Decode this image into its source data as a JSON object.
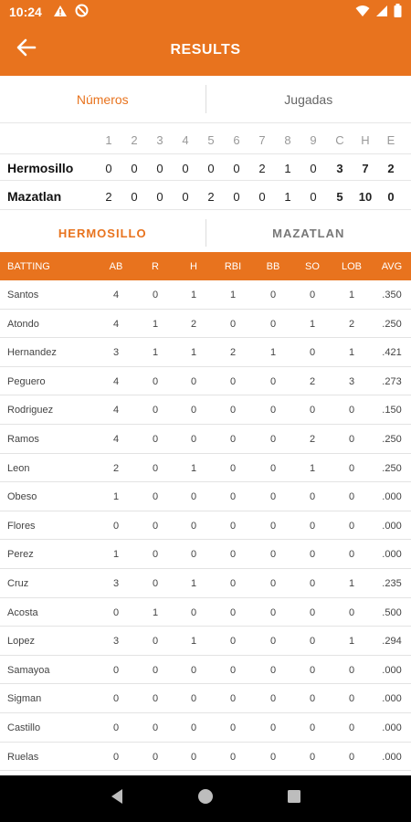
{
  "status_bar": {
    "time": "10:24",
    "left_icons": [
      "alert-icon",
      "no-disturb-icon"
    ],
    "right_icons": [
      "wifi-icon",
      "signal-icon",
      "battery-icon"
    ]
  },
  "app_bar": {
    "title": "RESULTS",
    "back_icon": "back-arrow-icon"
  },
  "top_tabs": [
    {
      "label": "Números",
      "active": true
    },
    {
      "label": "Jugadas",
      "active": false
    }
  ],
  "linescore": {
    "headers": [
      "1",
      "2",
      "3",
      "4",
      "5",
      "6",
      "7",
      "8",
      "9",
      "C",
      "H",
      "E"
    ],
    "teams": [
      {
        "name": "Hermosillo",
        "innings": [
          "0",
          "0",
          "0",
          "0",
          "0",
          "0",
          "2",
          "1",
          "0"
        ],
        "C": "3",
        "H": "7",
        "E": "2"
      },
      {
        "name": "Mazatlan",
        "innings": [
          "2",
          "0",
          "0",
          "0",
          "2",
          "0",
          "0",
          "1",
          "0"
        ],
        "C": "5",
        "H": "10",
        "E": "0"
      }
    ]
  },
  "team_tabs": [
    {
      "label": "HERMOSILLO",
      "active": true
    },
    {
      "label": "MAZATLAN",
      "active": false
    }
  ],
  "batting": {
    "headers": [
      "BATTING",
      "AB",
      "R",
      "H",
      "RBI",
      "BB",
      "SO",
      "LOB",
      "AVG"
    ],
    "rows": [
      [
        "Santos",
        "4",
        "0",
        "1",
        "1",
        "0",
        "0",
        "1",
        ".350"
      ],
      [
        "Atondo",
        "4",
        "1",
        "2",
        "0",
        "0",
        "1",
        "2",
        ".250"
      ],
      [
        "Hernandez",
        "3",
        "1",
        "1",
        "2",
        "1",
        "0",
        "1",
        ".421"
      ],
      [
        "Peguero",
        "4",
        "0",
        "0",
        "0",
        "0",
        "2",
        "3",
        ".273"
      ],
      [
        "Rodriguez",
        "4",
        "0",
        "0",
        "0",
        "0",
        "0",
        "0",
        ".150"
      ],
      [
        "Ramos",
        "4",
        "0",
        "0",
        "0",
        "0",
        "2",
        "0",
        ".250"
      ],
      [
        "Leon",
        "2",
        "0",
        "1",
        "0",
        "0",
        "1",
        "0",
        ".250"
      ],
      [
        "Obeso",
        "1",
        "0",
        "0",
        "0",
        "0",
        "0",
        "0",
        ".000"
      ],
      [
        "Flores",
        "0",
        "0",
        "0",
        "0",
        "0",
        "0",
        "0",
        ".000"
      ],
      [
        "Perez",
        "1",
        "0",
        "0",
        "0",
        "0",
        "0",
        "0",
        ".000"
      ],
      [
        "Cruz",
        "3",
        "0",
        "1",
        "0",
        "0",
        "0",
        "1",
        ".235"
      ],
      [
        "Acosta",
        "0",
        "1",
        "0",
        "0",
        "0",
        "0",
        "0",
        ".500"
      ],
      [
        "Lopez",
        "3",
        "0",
        "1",
        "0",
        "0",
        "0",
        "1",
        ".294"
      ],
      [
        "Samayoa",
        "0",
        "0",
        "0",
        "0",
        "0",
        "0",
        "0",
        ".000"
      ],
      [
        "Sigman",
        "0",
        "0",
        "0",
        "0",
        "0",
        "0",
        "0",
        ".000"
      ],
      [
        "Castillo",
        "0",
        "0",
        "0",
        "0",
        "0",
        "0",
        "0",
        ".000"
      ],
      [
        "Ruelas",
        "0",
        "0",
        "0",
        "0",
        "0",
        "0",
        "0",
        ".000"
      ]
    ]
  },
  "nav_bar": {
    "icons": [
      "nav-back-icon",
      "nav-home-icon",
      "nav-recents-icon"
    ]
  },
  "colors": {
    "accent": "#E8731E",
    "nav_background": "#000000"
  }
}
